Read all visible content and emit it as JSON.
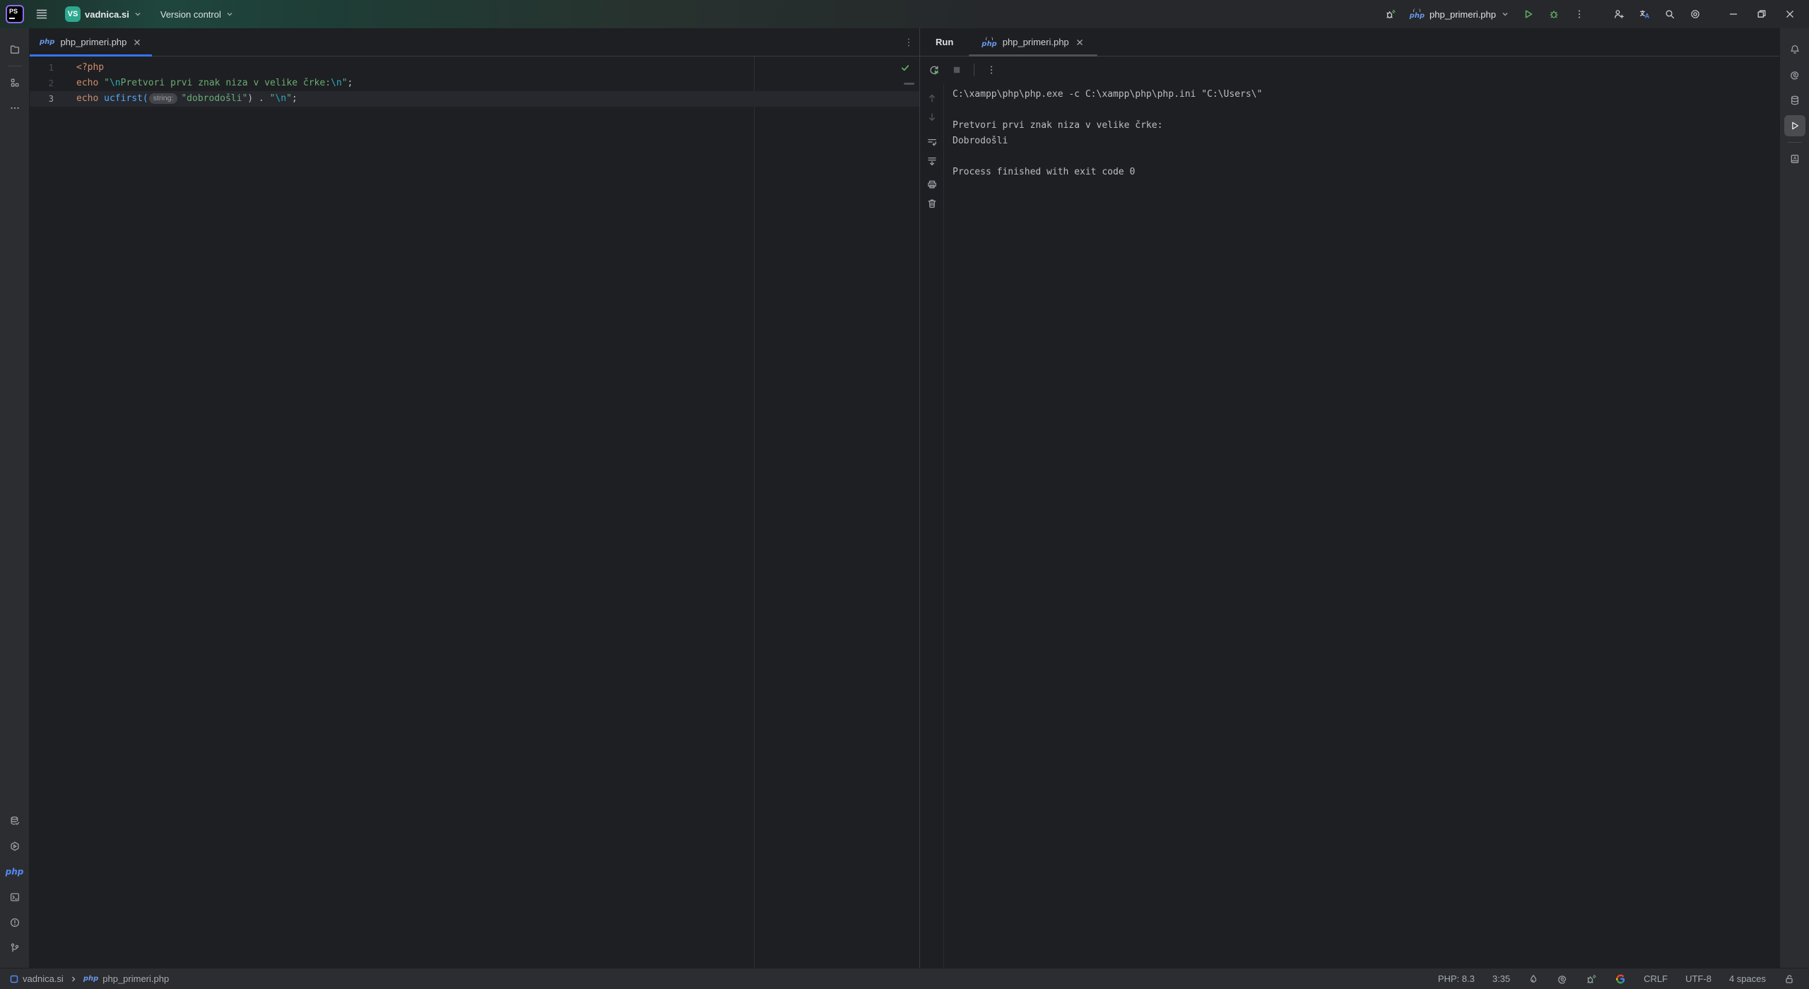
{
  "titlebar": {
    "logo_text": "PS",
    "project": {
      "avatar": "VS",
      "name": "vadnica.si"
    },
    "version_control_label": "Version control",
    "run_config_name": "php_primeri.php"
  },
  "icons": {
    "php_label": "php",
    "left_rail_top": [
      "project-folder",
      "structure",
      "more-tool-windows"
    ],
    "left_rail_bottom": [
      "database",
      "services",
      "php-console",
      "terminal",
      "problems",
      "version-control"
    ],
    "right_rail": [
      "notifications",
      "ai-assistant",
      "database",
      "run",
      "documentation"
    ],
    "console_toolbar": [
      "rerun",
      "stop",
      "more"
    ],
    "console_gutter": [
      "up-stack-trace",
      "down-stack-trace",
      "soft-wrap",
      "scroll-to-end",
      "print",
      "clear-all"
    ]
  },
  "editor": {
    "tab_label": "php_primeri.php",
    "code": {
      "lines": [
        {
          "num": "1",
          "current": false,
          "tokens": [
            {
              "t": "<?php",
              "c": "kw"
            }
          ]
        },
        {
          "num": "2",
          "current": false,
          "tokens": [
            {
              "t": "echo ",
              "c": "kw"
            },
            {
              "t": "\"",
              "c": "str"
            },
            {
              "t": "\\n",
              "c": "esc"
            },
            {
              "t": "Pretvori prvi znak niza v velike črke:",
              "c": "str"
            },
            {
              "t": "\\n",
              "c": "esc"
            },
            {
              "t": "\"",
              "c": "str"
            },
            {
              "t": ";",
              "c": "plain"
            }
          ]
        },
        {
          "num": "3",
          "current": true,
          "tokens": [
            {
              "t": "echo ",
              "c": "kw"
            },
            {
              "t": "ucfirst(",
              "c": "fn"
            },
            {
              "t": "string:",
              "c": "hint"
            },
            {
              "t": "\"dobrodošli\"",
              "c": "str"
            },
            {
              "t": ") . ",
              "c": "plain"
            },
            {
              "t": "\"",
              "c": "str"
            },
            {
              "t": "\\n",
              "c": "esc"
            },
            {
              "t": "\"",
              "c": "str"
            },
            {
              "t": ";",
              "c": "plain"
            }
          ]
        }
      ]
    }
  },
  "run_panel": {
    "title": "Run",
    "tab_label": "php_primeri.php",
    "console_lines": [
      "C:\\xampp\\php\\php.exe -c C:\\xampp\\php\\php.ini \"C:\\Users\\\"",
      "",
      "Pretvori prvi znak niza v velike črke:",
      "Dobrodošli",
      "",
      "Process finished with exit code 0"
    ]
  },
  "statusbar": {
    "breadcrumb": [
      "vadnica.si",
      "php_primeri.php"
    ],
    "php_version": "PHP: 8.3",
    "caret_position": "3:35",
    "line_separator": "CRLF",
    "encoding": "UTF-8",
    "indent": "4 spaces"
  },
  "colors": {
    "accent_blue": "#3574F0",
    "project_avatar": "#2DA88F",
    "run_green": "#5FAD65",
    "keyword_orange": "#CF8E6D",
    "string_green": "#6AAB73",
    "escape_cyan": "#2AACB8",
    "function_blue": "#56A8F5",
    "editor_bg": "#1E1F22",
    "panel_bg": "#2B2D30"
  }
}
